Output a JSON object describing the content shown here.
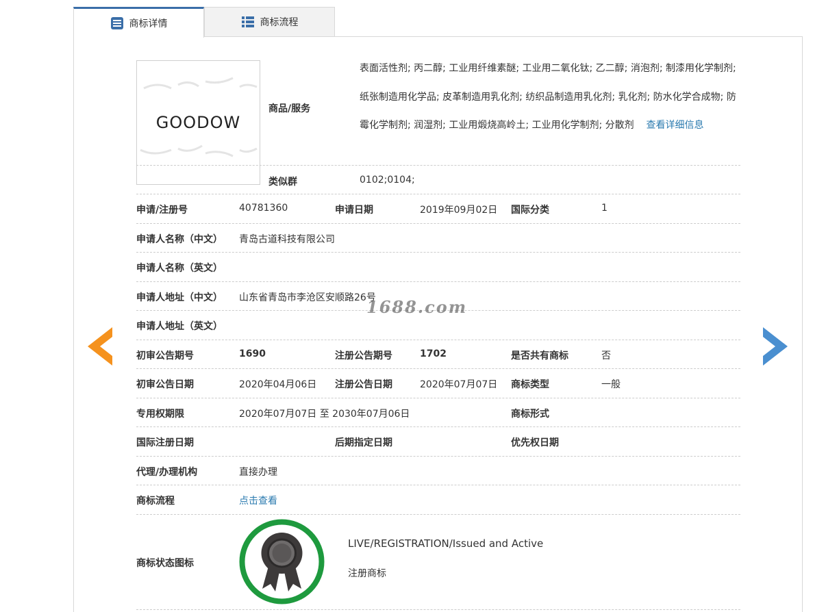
{
  "tabs": [
    {
      "label": "商标详情",
      "active": true,
      "icon": "list-doc-icon"
    },
    {
      "label": "商标流程",
      "active": false,
      "icon": "grid-list-icon"
    }
  ],
  "logo": {
    "text": "GOODOW"
  },
  "goods": {
    "label": "商品/服务",
    "text": "表面活性剂; 丙二醇; 工业用纤维素醚; 工业用二氧化钛; 乙二醇; 消泡剂; 制漆用化学制剂; 纸张制造用化学品; 皮革制造用乳化剂; 纺织品制造用乳化剂; 乳化剂; 防水化学合成物; 防霉化学制剂; 润湿剂; 工业用煅烧高岭土; 工业用化学制剂; 分散剂",
    "more_link": "查看详细信息"
  },
  "similar_group": {
    "label": "类似群",
    "value": "0102;0104;"
  },
  "rows": {
    "reg_no": {
      "label": "申请/注册号",
      "value": "40781360"
    },
    "apply_date": {
      "label": "申请日期",
      "value": "2019年09月02日"
    },
    "intl_class": {
      "label": "国际分类",
      "value": "1"
    },
    "applicant_cn": {
      "label": "申请人名称（中文）",
      "value": "青岛古道科技有限公司"
    },
    "applicant_en": {
      "label": "申请人名称（英文）",
      "value": ""
    },
    "address_cn": {
      "label": "申请人地址（中文）",
      "value": "山东省青岛市李沧区安顺路26号"
    },
    "address_en": {
      "label": "申请人地址（英文）",
      "value": ""
    },
    "prelim_issue": {
      "label": "初审公告期号",
      "value": "1690"
    },
    "reg_issue": {
      "label": "注册公告期号",
      "value": "1702"
    },
    "shared": {
      "label": "是否共有商标",
      "value": "否"
    },
    "prelim_date": {
      "label": "初审公告日期",
      "value": "2020年04月06日"
    },
    "reg_date": {
      "label": "注册公告日期",
      "value": "2020年07月07日"
    },
    "tm_type": {
      "label": "商标类型",
      "value": "一般"
    },
    "exclusive_period": {
      "label": "专用权期限",
      "value": "2020年07月07日 至 2030年07月06日"
    },
    "tm_form": {
      "label": "商标形式",
      "value": ""
    },
    "intl_reg_date": {
      "label": "国际注册日期",
      "value": ""
    },
    "later_date": {
      "label": "后期指定日期",
      "value": ""
    },
    "priority_date": {
      "label": "优先权日期",
      "value": ""
    },
    "agent": {
      "label": "代理/办理机构",
      "value": "直接办理"
    },
    "process": {
      "label": "商标流程",
      "value": "点击查看"
    }
  },
  "status": {
    "label": "商标状态图标",
    "en": "LIVE/REGISTRATION/Issued and Active",
    "cn": "注册商标",
    "ring_color": "#1e9a3e"
  },
  "site_watermark": "1688.com",
  "colors": {
    "accent": "#3a6ea8",
    "link": "#2a7aaf",
    "arrow_left": "#f5921e",
    "arrow_right": "#4a8fd0"
  }
}
